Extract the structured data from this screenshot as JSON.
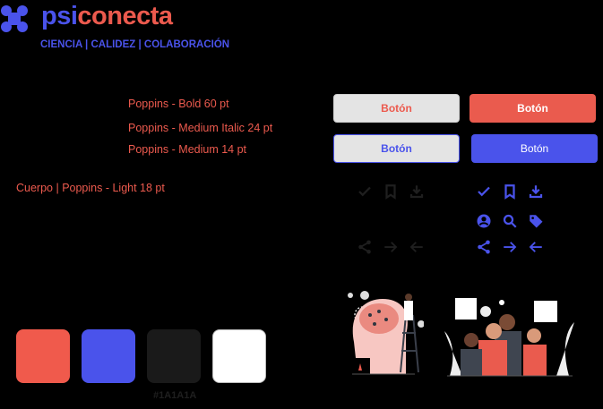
{
  "brand": {
    "name_part1": "psi",
    "name_part2": "conecta",
    "tagline": "CIENCIA | CALIDEZ | COLABORACIÓN"
  },
  "typography": {
    "bold": "Poppins - Bold 60 pt",
    "medium_italic": "Poppins - Medium Italic 24 pt",
    "medium": "Poppins - Medium 14 pt",
    "body": "Cuerpo | Poppins - Light 18 pt"
  },
  "buttons": [
    {
      "label": "Botón",
      "variant": "secondary-red"
    },
    {
      "label": "Botón",
      "variant": "primary-red"
    },
    {
      "label": "Botón",
      "variant": "secondary-blue"
    },
    {
      "label": "Botón",
      "variant": "primary-blue"
    }
  ],
  "icons": {
    "dark": [
      "check-icon",
      "bookmark-icon",
      "download-icon",
      "share-icon",
      "arrow-right-icon",
      "arrow-left-icon"
    ],
    "blue": [
      "check-icon",
      "bookmark-icon",
      "download-icon",
      "user-icon",
      "search-icon",
      "tag-icon",
      "share-icon",
      "arrow-right-icon",
      "arrow-left-icon"
    ]
  },
  "palette": {
    "colors": [
      "#F05A4C",
      "#4A53EB",
      "#1A1A1A",
      "#FFFFFF"
    ],
    "label": "#1A1A1A"
  }
}
